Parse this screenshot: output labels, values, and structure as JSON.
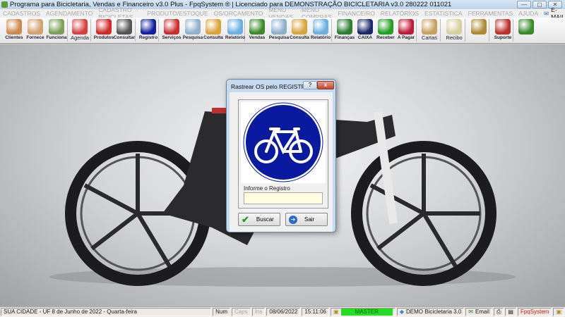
{
  "window": {
    "title": "Programa para Bicicletaria, Vendas e Financeiro v3.0 Plus - FpqSystem ® | Licenciado para  DEMONSTRAÇÃO BICICLETARIA v3.0 280222 011021",
    "controls": [
      "—",
      "▢",
      "✕"
    ]
  },
  "menu": [
    "CADASTROS",
    "AGENDAMENTO",
    "CADASTRO BICICLETAS",
    "PRODUTO/ESTOQUE",
    "OS/ORÇAMENTO",
    "MENU VENDAS",
    "MENU COMPRAS",
    "FINANCEIRO",
    "RELATÓRIOS",
    "ESTATISTICA",
    "FERRAMENTAS",
    "AJUDA"
  ],
  "menu_email": "E-MAIL",
  "toolbar": [
    {
      "label": "Clientes",
      "color": "#c98a4a"
    },
    {
      "label": "Fornece",
      "color": "#d3a070"
    },
    {
      "label": "Funciona",
      "color": "#7aa05a"
    },
    {
      "label": "Agenda",
      "color": "#d94040"
    },
    {
      "label": "Produtos",
      "color": "#d02a2a"
    },
    {
      "label": "Consultar",
      "color": "#555555"
    },
    {
      "label": "Registro",
      "color": "#1020a0"
    },
    {
      "label": "Serviços",
      "color": "#c83030"
    },
    {
      "label": "Pesquisa",
      "color": "#8fb0cc"
    },
    {
      "label": "Consulta",
      "color": "#d9a43a"
    },
    {
      "label": "Relatório",
      "color": "#6ab0e0"
    },
    {
      "label": "Vendas",
      "color": "#3c8a2a"
    },
    {
      "label": "Pesquisa",
      "color": "#8fb0cc"
    },
    {
      "label": "Consulta",
      "color": "#d9a43a"
    },
    {
      "label": "Relatório",
      "color": "#6ab0e0"
    },
    {
      "label": "Finanças",
      "color": "#2e7d32"
    },
    {
      "label": "CAIXA",
      "color": "#1b2a6b"
    },
    {
      "label": "Receber",
      "color": "#22a022"
    },
    {
      "label": "A Pagar",
      "color": "#c0183a"
    },
    {
      "label": "Cartas",
      "color": "#c8a060"
    },
    {
      "label": "Recibo",
      "color": "#d8d0a0"
    },
    {
      "label": "",
      "color": "#b08a30"
    },
    {
      "label": "Suporte",
      "color": "#c0302a"
    },
    {
      "label": "",
      "color": "#3a8a2a"
    }
  ],
  "dialog": {
    "title": "Rastrear OS pelo REGISTRO",
    "help": "?",
    "close": "x",
    "field_label": "Informe o Registro",
    "field_value": "",
    "search_label": "Buscar",
    "exit_label": "Sair"
  },
  "status": {
    "city": "SUA CIDADE - UF  8 de Junho de 2022 - Quarta-feira",
    "num": "Num",
    "caps": "Caps",
    "ins": "Ins",
    "date": "08/06/2022",
    "time": "15:11:06",
    "user": "MASTER",
    "company": "DEMO Bicicletaria 3.0",
    "email": "Email",
    "brand": "FpqSystem"
  }
}
